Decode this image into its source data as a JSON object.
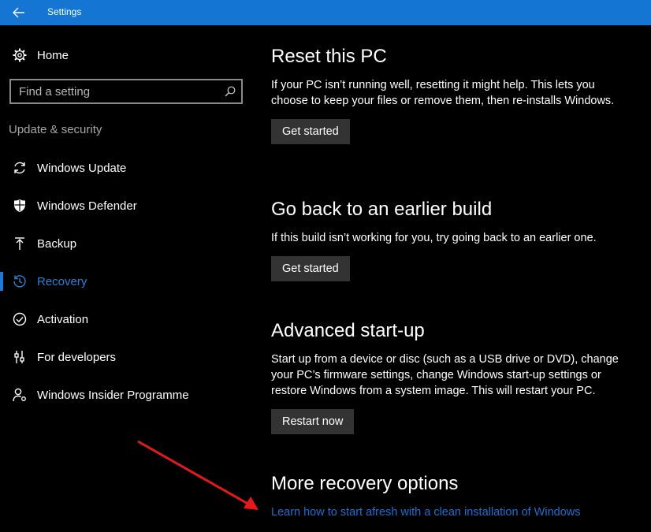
{
  "titlebar": {
    "title": "Settings",
    "back_icon": "back-arrow-icon",
    "color": "#1476d2"
  },
  "sidebar": {
    "home": {
      "label": "Home",
      "icon": "gear-icon"
    },
    "search": {
      "placeholder": "Find a setting",
      "value": "",
      "icon": "search-icon"
    },
    "section_heading": "Update & security",
    "items": [
      {
        "label": "Windows Update",
        "icon": "sync-icon",
        "active": false
      },
      {
        "label": "Windows Defender",
        "icon": "shield-icon",
        "active": false
      },
      {
        "label": "Backup",
        "icon": "upload-icon",
        "active": false
      },
      {
        "label": "Recovery",
        "icon": "history-icon",
        "active": true
      },
      {
        "label": "Activation",
        "icon": "check-circle-icon",
        "active": false
      },
      {
        "label": "For developers",
        "icon": "developer-tools-icon",
        "active": false
      },
      {
        "label": "Windows Insider Programme",
        "icon": "person-settings-icon",
        "active": false
      }
    ],
    "accent": "#1e78d7"
  },
  "main": {
    "reset": {
      "title": "Reset this PC",
      "description": "If your PC isn’t running well, resetting it might help. This lets you choose to keep your files or remove them, then re-installs Windows.",
      "button": "Get started"
    },
    "go_back": {
      "title": "Go back to an earlier build",
      "description": "If this build isn’t working for you, try going back to an earlier one.",
      "button": "Get started"
    },
    "advanced": {
      "title": "Advanced start-up",
      "description": "Start up from a device or disc (such as a USB drive or DVD), change your PC’s firmware settings, change Windows start-up settings or restore Windows from a system image. This will restart your PC.",
      "button": "Restart now"
    },
    "more": {
      "title": "More recovery options",
      "link": "Learn how to start afresh with a clean installation of Windows"
    }
  },
  "annotation": {
    "arrow_color": "#e5191c"
  }
}
